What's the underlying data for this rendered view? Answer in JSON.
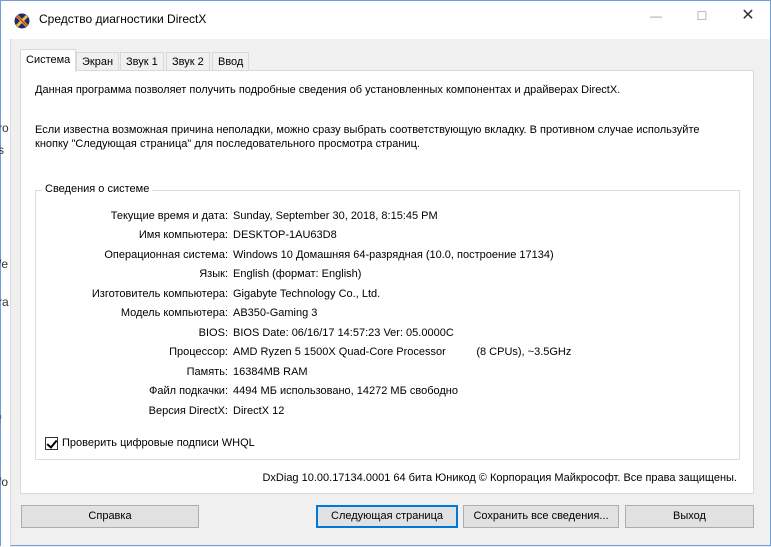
{
  "window": {
    "title": "Средство диагностики DirectX",
    "controls": {
      "minimize": "—",
      "maximize": "☐",
      "close": "✕"
    }
  },
  "background_window": {
    "fragments": [
      "ro",
      "s",
      "/e",
      "ra",
      "f",
      "fo"
    ]
  },
  "tabs": [
    {
      "label": "Система",
      "active": true
    },
    {
      "label": "Экран",
      "active": false
    },
    {
      "label": "Звук 1",
      "active": false
    },
    {
      "label": "Звук 2",
      "active": false
    },
    {
      "label": "Ввод",
      "active": false
    }
  ],
  "intro": {
    "line1": "Данная программа позволяет получить подробные сведения об установленных компонентах и драйверах DirectX.",
    "line2": "Если известна возможная причина неполадки, можно сразу выбрать соответствующую вкладку. В противном случае используйте кнопку \"Следующая страница\" для последовательного просмотра страниц."
  },
  "system_info": {
    "title": "Сведения о системе",
    "rows": [
      {
        "label": "Текущие время и дата:",
        "value": "Sunday, September 30, 2018, 8:15:45 PM"
      },
      {
        "label": "Имя компьютера:",
        "value": "DESKTOP-1AU63D8"
      },
      {
        "label": "Операционная система:",
        "value": "Windows 10 Домашняя 64-разрядная (10.0, построение 17134)"
      },
      {
        "label": "Язык:",
        "value": "English (формат: English)"
      },
      {
        "label": "Изготовитель компьютера:",
        "value": "Gigabyte Technology Co., Ltd."
      },
      {
        "label": "Модель компьютера:",
        "value": "AB350-Gaming 3"
      },
      {
        "label": "BIOS:",
        "value": "BIOS Date: 06/16/17 14:57:23 Ver: 05.0000C"
      },
      {
        "label": "Процессор:",
        "value": "AMD Ryzen 5 1500X Quad-Core Processor          (8 CPUs), ~3.5GHz"
      },
      {
        "label": "Память:",
        "value": "16384MB RAM"
      },
      {
        "label": "Файл подкачки:",
        "value": "4494 МБ использовано, 14272 МБ свободно"
      },
      {
        "label": "Версия DirectX:",
        "value": "DirectX 12"
      }
    ]
  },
  "whql_checkbox": {
    "label": "Проверить цифровые подписи WHQL",
    "checked": true
  },
  "footer": "DxDiag 10.00.17134.0001 64 бита Юникод © Корпорация Майкрософт. Все права защищены.",
  "buttons": {
    "help": "Справка",
    "next": "Следующая страница",
    "save": "Сохранить все сведения...",
    "exit": "Выход"
  }
}
